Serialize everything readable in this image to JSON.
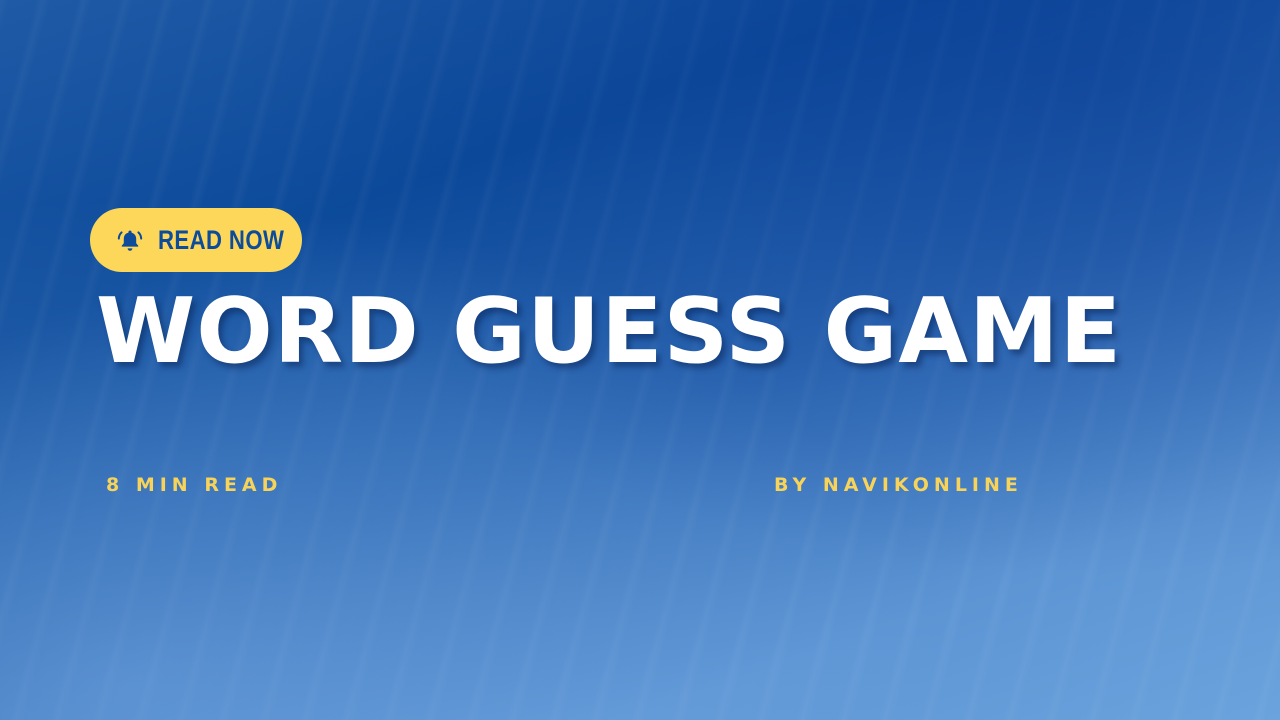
{
  "banner": {
    "badge": {
      "label": "READ NOW",
      "icon": "bell-ringing-icon",
      "background_color": "#fcd75a",
      "text_color": "#0d4b9b"
    },
    "title": "WORD GUESS GAME",
    "read_time": "8 MIN READ",
    "author": "BY NAVIKONLINE",
    "colors": {
      "background_primary": "#0c4a9a",
      "background_light": "#6aa3dd",
      "title": "#ffffff",
      "meta": "#f7d35a"
    }
  }
}
